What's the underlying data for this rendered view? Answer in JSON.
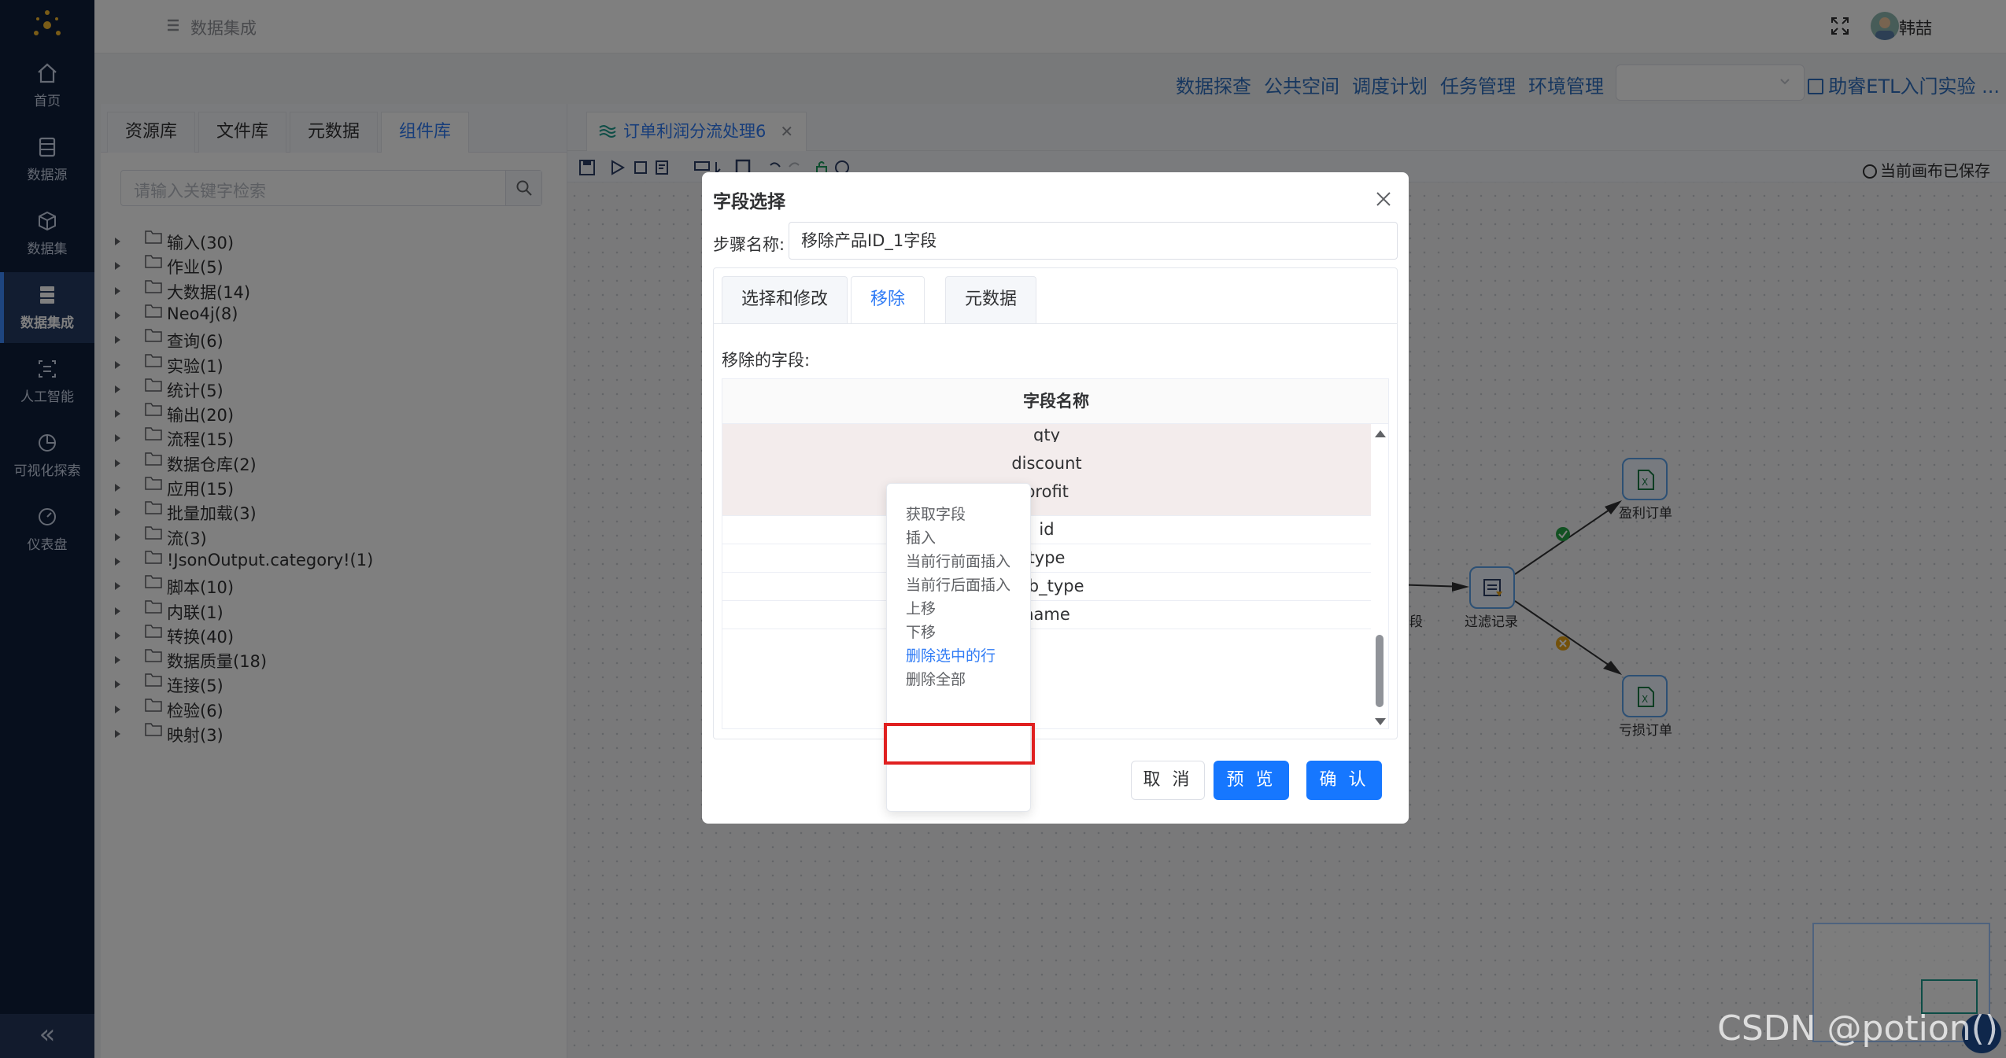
{
  "nav": {
    "items": [
      {
        "label": "首页",
        "icon": "home-icon"
      },
      {
        "label": "数据源",
        "icon": "database-icon"
      },
      {
        "label": "数据集",
        "icon": "cube-icon"
      },
      {
        "label": "数据集成",
        "icon": "server-icon"
      },
      {
        "label": "人工智能",
        "icon": "ai-icon"
      },
      {
        "label": "可视化探索",
        "icon": "pie-chart-icon"
      },
      {
        "label": "仪表盘",
        "icon": "gauge-icon"
      }
    ],
    "active_index": 3,
    "collapse_label": "«"
  },
  "topbar": {
    "breadcrumb": "数据集成",
    "user_name": "韩喆"
  },
  "topmenu": {
    "items": [
      "数据探查",
      "公共空间",
      "调度计划",
      "任务管理",
      "环境管理"
    ],
    "select_value": "",
    "guide_label": "助睿ETL入门实验 ..."
  },
  "leftpanel": {
    "tabs": [
      "资源库",
      "文件库",
      "元数据",
      "组件库"
    ],
    "active_tab": 3,
    "search_placeholder": "请输入关键字检索",
    "tree": [
      "输入(30)",
      "作业(5)",
      "大数据(14)",
      "Neo4j(8)",
      "查询(6)",
      "实验(1)",
      "统计(5)",
      "输出(20)",
      "流程(15)",
      "数据仓库(2)",
      "应用(15)",
      "批量加载(3)",
      "流(3)",
      "!JsonOutput.category!(1)",
      "脚本(10)",
      "内联(1)",
      "转换(40)",
      "数据质量(18)",
      "连接(5)",
      "检验(6)",
      "映射(3)"
    ]
  },
  "canvas": {
    "tab_title": "订单利润分流处理6",
    "saved_label": "当前画布已保存",
    "nodes": {
      "filter": "过滤记录",
      "profit": "盈利订单",
      "loss": "亏损订单",
      "partial_left": "段"
    }
  },
  "dialog": {
    "title": "字段选择",
    "step_name_label": "步骤名称:",
    "step_name_value": "移除产品ID_1字段",
    "tabs": [
      "选择和修改",
      "移除",
      "元数据"
    ],
    "active_tab": 1,
    "remove_label": "移除的字段:",
    "column_header": "字段名称",
    "rows": [
      {
        "name": "qty",
        "selected": true
      },
      {
        "name": "discount",
        "selected": true
      },
      {
        "name": "profit",
        "selected": true
      },
      {
        "name": "id",
        "selected": false
      },
      {
        "name": "type",
        "selected": false
      },
      {
        "name": "sub_type",
        "selected": false
      },
      {
        "name": "name",
        "selected": false
      }
    ],
    "buttons": {
      "cancel": "取 消",
      "preview": "预 览",
      "confirm": "确 认"
    }
  },
  "context_menu": {
    "items": [
      "获取字段",
      "插入",
      "当前行前面插入",
      "当前行后面插入",
      "上移",
      "下移",
      "删除选中的行",
      "删除全部"
    ],
    "highlighted_index": 6
  },
  "watermark": "CSDN @potion()",
  "colors": {
    "nav_bg": "#0f1f3a",
    "accent": "#1677ff",
    "link": "#2f6fbf",
    "highlight_box": "#e02020",
    "selected_row": "#f3ecec"
  }
}
